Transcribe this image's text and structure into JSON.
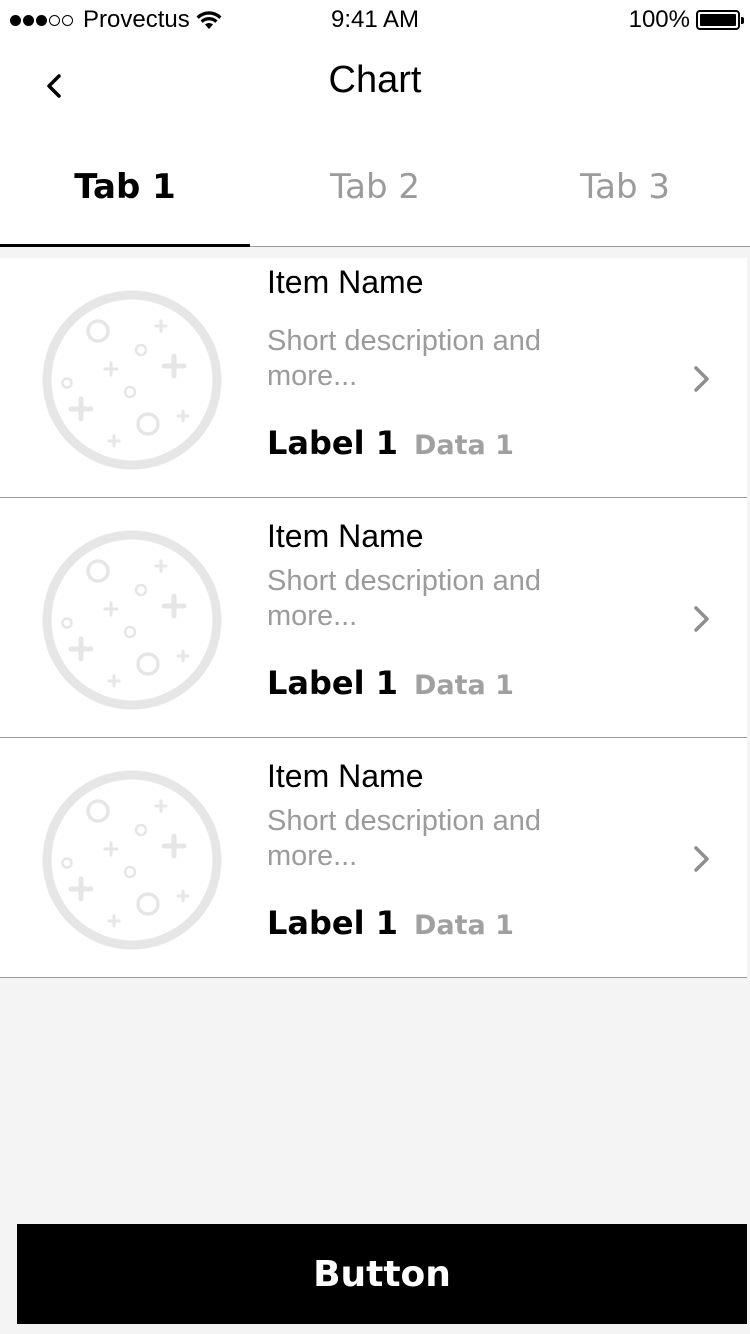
{
  "status_bar": {
    "carrier": "Provectus",
    "signal_filled": 3,
    "signal_total": 5,
    "time": "9:41 AM",
    "battery_percent": "100%",
    "icons": [
      "signal-dots-icon",
      "wifi-icon",
      "battery-icon"
    ]
  },
  "nav": {
    "title": "Chart",
    "back_icon": "chevron-left-icon"
  },
  "tabs": [
    {
      "label": "Tab 1",
      "active": true
    },
    {
      "label": "Tab 2",
      "active": false
    },
    {
      "label": "Tab 3",
      "active": false
    }
  ],
  "items": [
    {
      "name": "Item Name",
      "description": "Short description and more...",
      "label": "Label 1",
      "data": "Data 1",
      "thumbnail_icon": "planet-placeholder-icon",
      "trailing_icon": "chevron-right-icon"
    },
    {
      "name": "Item Name",
      "description": "Short description and more...",
      "label": "Label 1",
      "data": "Data 1",
      "thumbnail_icon": "planet-placeholder-icon",
      "trailing_icon": "chevron-right-icon"
    },
    {
      "name": "Item Name",
      "description": "Short description and more...",
      "label": "Label 1",
      "data": "Data 1",
      "thumbnail_icon": "planet-placeholder-icon",
      "trailing_icon": "chevron-right-icon"
    }
  ],
  "button": {
    "label": "Button"
  },
  "colors": {
    "background": "#f4f4f4",
    "surface": "#ffffff",
    "text_primary": "#000000",
    "text_secondary": "#9b9b9b",
    "divider": "#9a9a9a",
    "placeholder": "#e6e6e6",
    "button_bg": "#000000",
    "button_text": "#ffffff"
  }
}
